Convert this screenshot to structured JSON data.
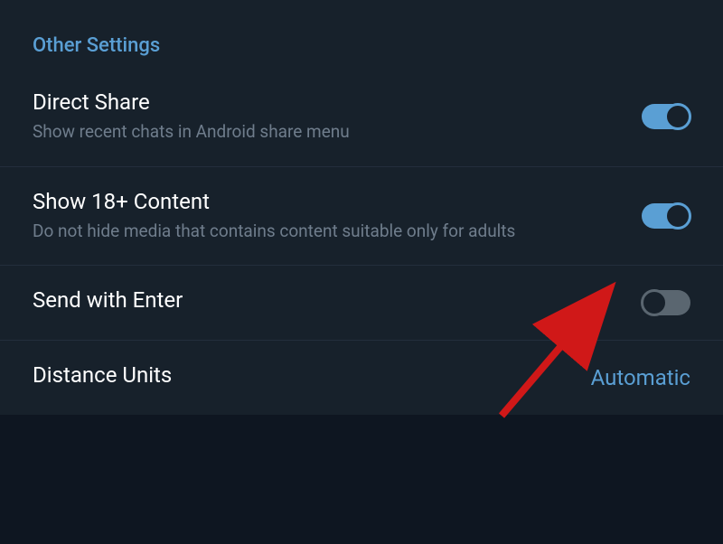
{
  "section": {
    "header": "Other Settings"
  },
  "settings": {
    "directShare": {
      "title": "Direct Share",
      "description": "Show recent chats in Android share menu",
      "enabled": true
    },
    "show18Plus": {
      "title": "Show 18+ Content",
      "description": "Do not hide media that contains content suitable only for adults",
      "enabled": true
    },
    "sendWithEnter": {
      "title": "Send with Enter",
      "enabled": false
    },
    "distanceUnits": {
      "title": "Distance Units",
      "value": "Automatic"
    }
  }
}
